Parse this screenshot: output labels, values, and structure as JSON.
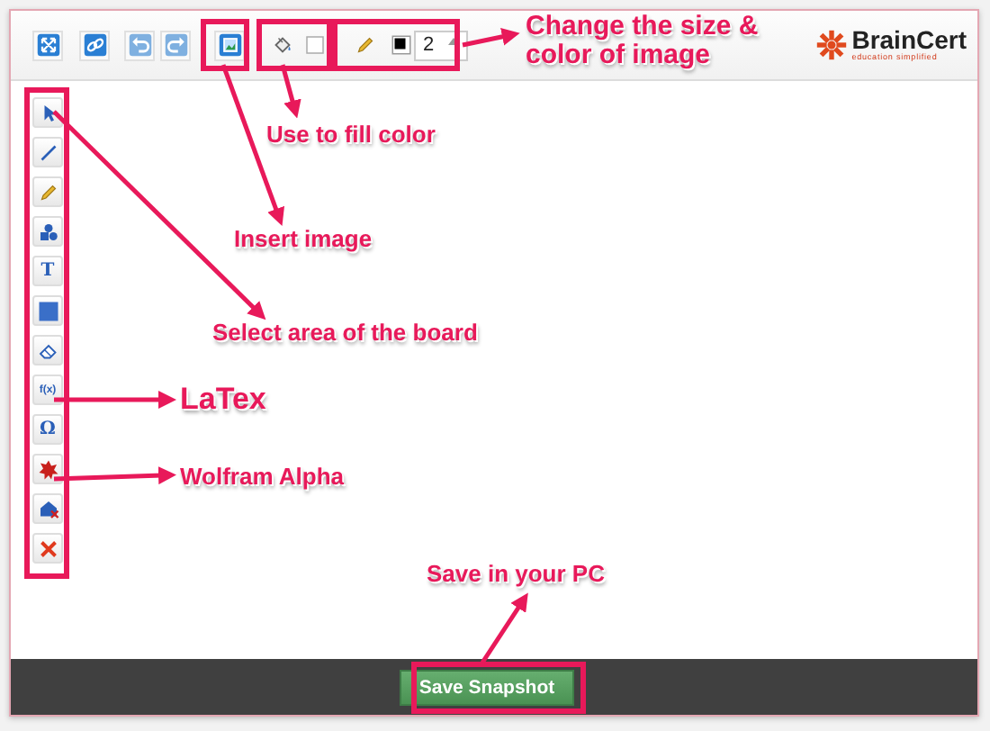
{
  "top_tools": [
    {
      "kind": "fullscreen"
    },
    {
      "kind": "link"
    },
    {
      "kind": "undo"
    },
    {
      "kind": "redo"
    },
    {
      "kind": "image"
    },
    {
      "kind": "fill"
    },
    {
      "kind": "fill-swatch"
    },
    {
      "kind": "pencil"
    },
    {
      "kind": "stroke-swatch"
    }
  ],
  "size_field": {
    "value": "2"
  },
  "logo": {
    "name": "BrainCert",
    "tagline": "education simplified"
  },
  "left_tools": [
    {
      "kind": "select"
    },
    {
      "kind": "line"
    },
    {
      "kind": "pencil"
    },
    {
      "kind": "shapes"
    },
    {
      "kind": "text",
      "glyph": "T"
    },
    {
      "kind": "rectangle"
    },
    {
      "kind": "eraser"
    },
    {
      "kind": "formula",
      "glyph": "f(x)"
    },
    {
      "kind": "symbol",
      "glyph": "Ω"
    },
    {
      "kind": "wolfram"
    },
    {
      "kind": "clear-shapes"
    },
    {
      "kind": "delete"
    }
  ],
  "save_button": {
    "label": "Save Snapshot"
  },
  "annotations": [
    {
      "text": "Change the size & color of image"
    },
    {
      "text": "Use to fill color"
    },
    {
      "text": "Insert image"
    },
    {
      "text": "Select area of the board"
    },
    {
      "text": "LaTex"
    },
    {
      "text": "Wolfram Alpha"
    },
    {
      "text": "Save in your PC"
    }
  ]
}
